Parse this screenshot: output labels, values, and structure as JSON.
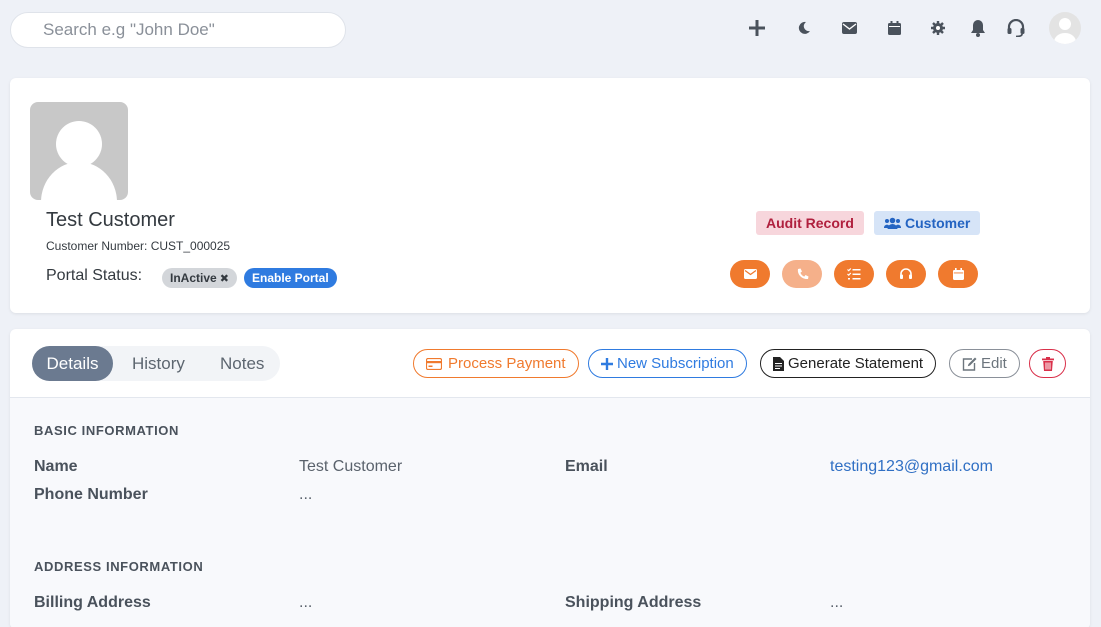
{
  "search": {
    "placeholder": "Search e.g \"John Doe\""
  },
  "topbar": {
    "icons": [
      "plus-icon",
      "moon-icon",
      "mail-icon",
      "calendar-icon",
      "gear-icon",
      "bell-icon",
      "headset-icon",
      "user-avatar"
    ]
  },
  "profile": {
    "name": "Test Customer",
    "customer_number": "Customer Number: CUST_000025",
    "portal_status_label": "Portal Status:",
    "portal_status_value": "InActive",
    "enable_portal_label": "Enable Portal",
    "badge_audit": "Audit Record",
    "badge_customer": "Customer",
    "action_icons": [
      "mail-icon",
      "phone-icon",
      "checklist-icon",
      "headset-icon",
      "calendar-icon"
    ]
  },
  "tabs": [
    {
      "label": "Details",
      "active": true
    },
    {
      "label": "History",
      "active": false
    },
    {
      "label": "Notes",
      "active": false
    }
  ],
  "buttons": {
    "process_payment": "Process Payment",
    "new_subscription": "New Subscription",
    "generate_statement": "Generate Statement",
    "edit": "Edit"
  },
  "basic_info": {
    "title": "BASIC INFORMATION",
    "name_label": "Name",
    "name_value": "Test Customer",
    "email_label": "Email",
    "email_value": "testing123@gmail.com",
    "phone_label": "Phone Number",
    "phone_value": "..."
  },
  "address_info": {
    "title": "ADDRESS INFORMATION",
    "billing_label": "Billing Address",
    "billing_value": "...",
    "shipping_label": "Shipping Address",
    "shipping_value": "..."
  },
  "colors": {
    "accent_orange": "#f07a2e",
    "accent_blue": "#2f7be0",
    "danger_red": "#d9304a",
    "tab_active": "#6b7a90"
  }
}
